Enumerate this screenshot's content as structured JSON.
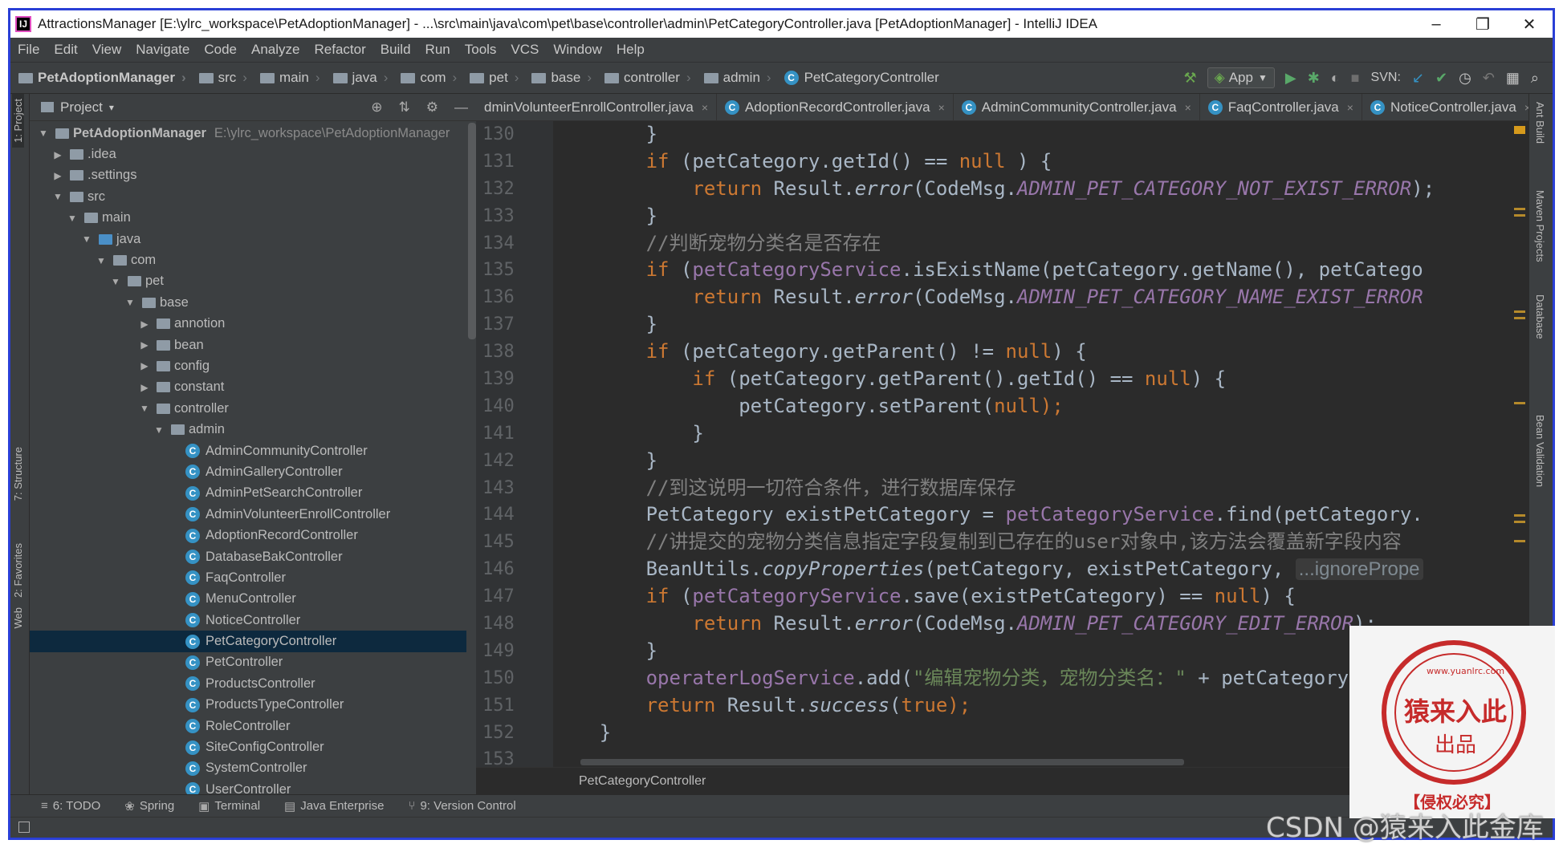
{
  "window": {
    "title": "AttractionsManager [E:\\ylrc_workspace\\PetAdoptionManager] - ...\\src\\main\\java\\com\\pet\\base\\controller\\admin\\PetCategoryController.java [PetAdoptionManager] - IntelliJ IDEA",
    "app_icon": "IJ",
    "minimize": "–",
    "restore": "❐",
    "close": "✕"
  },
  "menu": [
    "File",
    "Edit",
    "View",
    "Navigate",
    "Code",
    "Analyze",
    "Refactor",
    "Build",
    "Run",
    "Tools",
    "VCS",
    "Window",
    "Help"
  ],
  "breadcrumb": [
    "PetAdoptionManager",
    "src",
    "main",
    "java",
    "com",
    "pet",
    "base",
    "controller",
    "admin",
    "PetCategoryController"
  ],
  "toolbar": {
    "run_config": "App",
    "svn_label": "SVN:"
  },
  "left_stripe": {
    "project": "1: Project",
    "structure": "7: Structure",
    "favorites": "2: Favorites",
    "web": "Web"
  },
  "right_stripe": {
    "ant": "Ant Build",
    "maven": "Maven Projects",
    "database": "Database",
    "bean": "Bean Validation"
  },
  "project_panel": {
    "title": "Project",
    "dropdown": "▾",
    "tree": [
      {
        "label": "PetAdoptionManager",
        "path": "E:\\ylrc_workspace\\PetAdoptionManager",
        "depth": 0,
        "type": "root",
        "expanded": true
      },
      {
        "label": ".idea",
        "depth": 1,
        "type": "folder",
        "expanded": false
      },
      {
        "label": ".settings",
        "depth": 1,
        "type": "folder",
        "expanded": false
      },
      {
        "label": "src",
        "depth": 1,
        "type": "folder",
        "expanded": true
      },
      {
        "label": "main",
        "depth": 2,
        "type": "folder",
        "expanded": true
      },
      {
        "label": "java",
        "depth": 3,
        "type": "folder-blue",
        "expanded": true
      },
      {
        "label": "com",
        "depth": 4,
        "type": "folder",
        "expanded": true
      },
      {
        "label": "pet",
        "depth": 5,
        "type": "folder",
        "expanded": true
      },
      {
        "label": "base",
        "depth": 6,
        "type": "folder",
        "expanded": true
      },
      {
        "label": "annotion",
        "depth": 7,
        "type": "folder",
        "expanded": false
      },
      {
        "label": "bean",
        "depth": 7,
        "type": "folder",
        "expanded": false
      },
      {
        "label": "config",
        "depth": 7,
        "type": "folder",
        "expanded": false
      },
      {
        "label": "constant",
        "depth": 7,
        "type": "folder",
        "expanded": false
      },
      {
        "label": "controller",
        "depth": 7,
        "type": "folder",
        "expanded": true
      },
      {
        "label": "admin",
        "depth": 8,
        "type": "folder",
        "expanded": true
      },
      {
        "label": "AdminCommunityController",
        "depth": 9,
        "type": "class"
      },
      {
        "label": "AdminGalleryController",
        "depth": 9,
        "type": "class"
      },
      {
        "label": "AdminPetSearchController",
        "depth": 9,
        "type": "class"
      },
      {
        "label": "AdminVolunteerEnrollController",
        "depth": 9,
        "type": "class"
      },
      {
        "label": "AdoptionRecordController",
        "depth": 9,
        "type": "class"
      },
      {
        "label": "DatabaseBakController",
        "depth": 9,
        "type": "class"
      },
      {
        "label": "FaqController",
        "depth": 9,
        "type": "class"
      },
      {
        "label": "MenuController",
        "depth": 9,
        "type": "class"
      },
      {
        "label": "NoticeController",
        "depth": 9,
        "type": "class"
      },
      {
        "label": "PetCategoryController",
        "depth": 9,
        "type": "class",
        "selected": true
      },
      {
        "label": "PetController",
        "depth": 9,
        "type": "class"
      },
      {
        "label": "ProductsController",
        "depth": 9,
        "type": "class"
      },
      {
        "label": "ProductsTypeController",
        "depth": 9,
        "type": "class"
      },
      {
        "label": "RoleController",
        "depth": 9,
        "type": "class"
      },
      {
        "label": "SiteConfigController",
        "depth": 9,
        "type": "class"
      },
      {
        "label": "SystemController",
        "depth": 9,
        "type": "class"
      },
      {
        "label": "UserController",
        "depth": 9,
        "type": "class"
      }
    ]
  },
  "tabs": [
    {
      "label": "dminVolunteerEnrollController.java",
      "icon": false
    },
    {
      "label": "AdoptionRecordController.java",
      "icon": true
    },
    {
      "label": "AdminCommunityController.java",
      "icon": true
    },
    {
      "label": "FaqController.java",
      "icon": true
    },
    {
      "label": "NoticeController.java",
      "icon": true
    }
  ],
  "tab_close": "×",
  "editor": {
    "line_numbers": [
      "130",
      "131",
      "132",
      "133",
      "134",
      "135",
      "136",
      "137",
      "138",
      "139",
      "140",
      "141",
      "142",
      "143",
      "144",
      "145",
      "146",
      "147",
      "148",
      "149",
      "150",
      "151",
      "152",
      "153"
    ],
    "lines": [
      [
        {
          "t": "        }"
        }
      ],
      [
        {
          "t": "        "
        },
        {
          "t": "if",
          "c": "kw"
        },
        {
          "t": " (petCategory.getId() == "
        },
        {
          "t": "null",
          "c": "kw"
        },
        {
          "t": " ) {"
        }
      ],
      [
        {
          "t": "            "
        },
        {
          "t": "return",
          "c": "kw"
        },
        {
          "t": " Result."
        },
        {
          "t": "error",
          "c": "it"
        },
        {
          "t": "(CodeMsg."
        },
        {
          "t": "ADMIN_PET_CATEGORY_NOT_EXIST_ERROR",
          "c": "cst"
        },
        {
          "t": ");"
        }
      ],
      [
        {
          "t": "        }"
        }
      ],
      [
        {
          "t": "        "
        },
        {
          "t": "//判断宠物分类名是否存在",
          "c": "cm"
        }
      ],
      [
        {
          "t": "        "
        },
        {
          "t": "if",
          "c": "kw"
        },
        {
          "t": " ("
        },
        {
          "t": "petCategoryService",
          "c": "fld"
        },
        {
          "t": ".isExistName(petCategory.getName(), petCatego"
        }
      ],
      [
        {
          "t": "            "
        },
        {
          "t": "return",
          "c": "kw"
        },
        {
          "t": " Result."
        },
        {
          "t": "error",
          "c": "it"
        },
        {
          "t": "(CodeMsg."
        },
        {
          "t": "ADMIN_PET_CATEGORY_NAME_EXIST_ERROR",
          "c": "cst"
        }
      ],
      [
        {
          "t": "        }"
        }
      ],
      [
        {
          "t": "        "
        },
        {
          "t": "if",
          "c": "kw"
        },
        {
          "t": " (petCategory.getParent() != "
        },
        {
          "t": "null",
          "c": "kw"
        },
        {
          "t": ") {"
        }
      ],
      [
        {
          "t": "            "
        },
        {
          "t": "if",
          "c": "kw"
        },
        {
          "t": " (petCategory.getParent().getId() == "
        },
        {
          "t": "null",
          "c": "kw"
        },
        {
          "t": ") {"
        }
      ],
      [
        {
          "t": "                petCategory.setParent("
        },
        {
          "t": "null",
          "c": "kw"
        },
        {
          "t": ");",
          "c": "kw"
        }
      ],
      [
        {
          "t": "            }"
        }
      ],
      [
        {
          "t": "        }"
        }
      ],
      [
        {
          "t": "        "
        },
        {
          "t": "//到这说明一切符合条件，进行数据库保存",
          "c": "cm"
        }
      ],
      [
        {
          "t": "        PetCategory existPetCategory = "
        },
        {
          "t": "petCategoryService",
          "c": "fld"
        },
        {
          "t": ".find(petCategory."
        }
      ],
      [
        {
          "t": "        "
        },
        {
          "t": "//讲提交的宠物分类信息指定字段复制到已存在的user对象中,该方法会覆盖新字段内容",
          "c": "cm"
        }
      ],
      [
        {
          "t": "        BeanUtils."
        },
        {
          "t": "copyProperties",
          "c": "it"
        },
        {
          "t": "(petCategory, existPetCategory, "
        },
        {
          "t": "...ignorePrope",
          "c": "hint"
        }
      ],
      [
        {
          "t": "        "
        },
        {
          "t": "if",
          "c": "kw"
        },
        {
          "t": " ("
        },
        {
          "t": "petCategoryService",
          "c": "fld"
        },
        {
          "t": ".save(existPetCategory) == "
        },
        {
          "t": "null",
          "c": "kw"
        },
        {
          "t": ") {"
        }
      ],
      [
        {
          "t": "            "
        },
        {
          "t": "return",
          "c": "kw"
        },
        {
          "t": " Result."
        },
        {
          "t": "error",
          "c": "it"
        },
        {
          "t": "(CodeMsg."
        },
        {
          "t": "ADMIN_PET_CATEGORY_EDIT_ERROR",
          "c": "cst"
        },
        {
          "t": ");"
        }
      ],
      [
        {
          "t": "        }"
        }
      ],
      [
        {
          "t": "        "
        },
        {
          "t": "operaterLogService",
          "c": "fld"
        },
        {
          "t": ".add("
        },
        {
          "t": "\"编辑宠物分类，宠物分类名：\"",
          "c": "str"
        },
        {
          "t": " + petCategory.getNam"
        }
      ],
      [
        {
          "t": "        "
        },
        {
          "t": "return",
          "c": "kw"
        },
        {
          "t": " Result."
        },
        {
          "t": "success",
          "c": "it"
        },
        {
          "t": "("
        },
        {
          "t": "true",
          "c": "kw"
        },
        {
          "t": ");",
          "c": "kw"
        }
      ],
      [
        {
          "t": "    }"
        }
      ],
      [
        {
          "t": ""
        }
      ]
    ],
    "breadcrumb": "PetCategoryController"
  },
  "bottom_tools": [
    {
      "icon": "≡",
      "label": "6: TODO",
      "name": "todo"
    },
    {
      "icon": "❀",
      "label": "Spring",
      "name": "spring"
    },
    {
      "icon": "▣",
      "label": "Terminal",
      "name": "terminal"
    },
    {
      "icon": "▤",
      "label": "Java Enterprise",
      "name": "java-enterprise"
    },
    {
      "icon": "⑂",
      "label": "9: Version Control",
      "name": "version-control"
    }
  ],
  "watermark": {
    "stamp_main": "猿来入此",
    "stamp_sub": "出品",
    "stamp_url": "www.yuanlrc.com",
    "stamp_footer": "【侵权必究】",
    "csdn": "CSDN @猿来入此金库"
  },
  "colors": {
    "keyword": "#cc7832",
    "constant": "#9876aa",
    "comment": "#808080",
    "string": "#6a8759",
    "selection": "#0d293e",
    "window_border": "#2a3fd6"
  }
}
